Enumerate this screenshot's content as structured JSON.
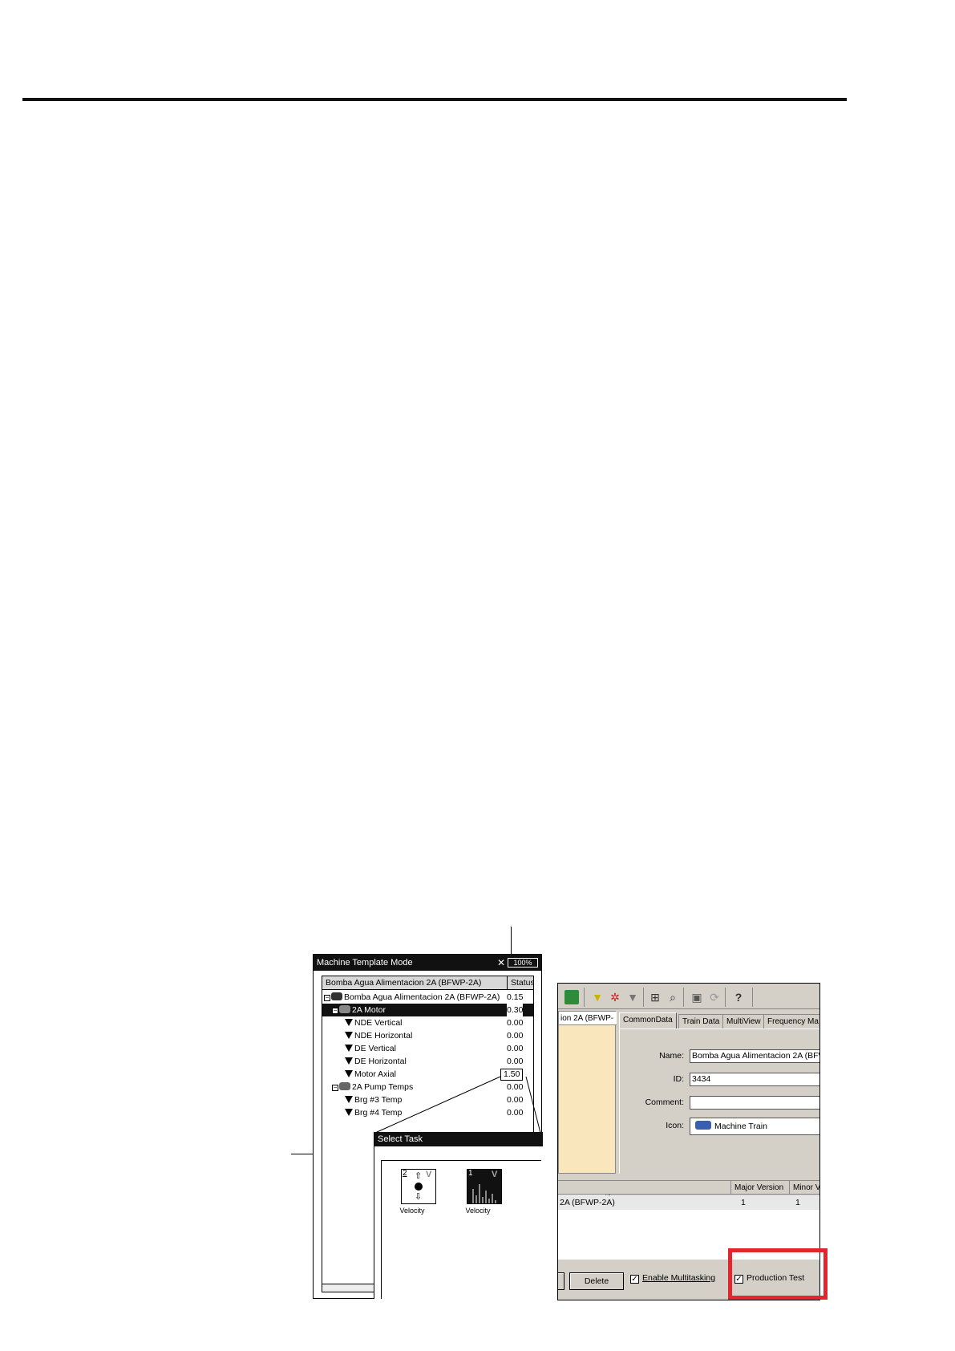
{
  "device": {
    "title": "Machine Template Mode",
    "battery": "100%",
    "tree_header_name": "Bomba Agua Alimentacion 2A (BFWP-2A)",
    "tree_header_status": "Status",
    "rows": [
      {
        "label": "Bomba Agua Alimentacion 2A (BFWP-2A)",
        "value": "0.15"
      },
      {
        "label": "2A Motor",
        "value": "0.30"
      },
      {
        "label": "NDE  Vertical",
        "value": "0.00"
      },
      {
        "label": "NDE  Horizontal",
        "value": "0.00"
      },
      {
        "label": "DE  Vertical",
        "value": "0.00"
      },
      {
        "label": "DE  Horizontal",
        "value": "0.00"
      },
      {
        "label": "Motor Axial",
        "value": "1.50"
      },
      {
        "label": "2A Pump Temps",
        "value": "0.00"
      },
      {
        "label": "Brg #3 Temp",
        "value": "0.00"
      },
      {
        "label": "Brg #4 Temp",
        "value": "0.00"
      }
    ]
  },
  "select_task": {
    "title": "Select Task",
    "tiles": [
      {
        "number": "2",
        "caption": "Velocity"
      },
      {
        "number": "1",
        "caption": "Velocity"
      }
    ]
  },
  "pc": {
    "left_tab": "ion 2A (BFWP-",
    "tabs": [
      "CommonData",
      "Train Data",
      "MultiView",
      "Frequency Ma"
    ],
    "form": {
      "name_label": "Name:",
      "name_value": "Bomba Agua Alimentacion 2A (BFWP",
      "id_label": "ID:",
      "id_value": "3434",
      "comment_label": "Comment:",
      "comment_value": "",
      "icon_label": "Icon:",
      "icon_value": "Machine Train"
    },
    "table": {
      "headers": [
        "Major Version",
        "Minor V"
      ],
      "row": {
        "name": "2A (BFWP-2A)",
        "major": "1",
        "minor": "1"
      }
    },
    "buttons": {
      "delete": "Delete",
      "enable_multitasking": "Enable Multitasking",
      "production_test": "Production Test"
    },
    "highlight_color": "#e1262d"
  }
}
